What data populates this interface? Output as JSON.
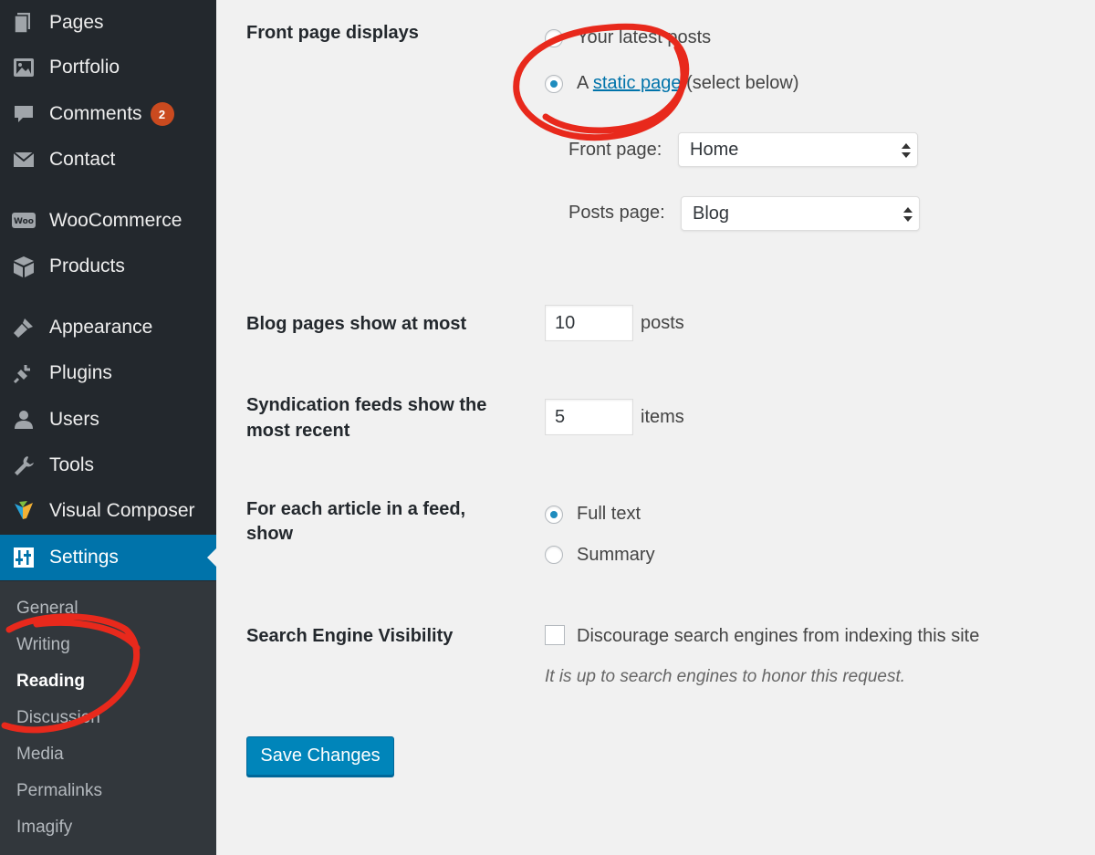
{
  "sidebar": {
    "menu": [
      {
        "label": "Pages",
        "icon": "pages-icon"
      },
      {
        "label": "Portfolio",
        "icon": "portfolio-icon"
      },
      {
        "label": "Comments",
        "icon": "comments-icon",
        "badge": "2"
      },
      {
        "label": "Contact",
        "icon": "contact-icon"
      },
      {
        "label": "WooCommerce",
        "icon": "woocommerce-icon"
      },
      {
        "label": "Products",
        "icon": "products-icon"
      },
      {
        "label": "Appearance",
        "icon": "appearance-icon"
      },
      {
        "label": "Plugins",
        "icon": "plugins-icon"
      },
      {
        "label": "Users",
        "icon": "users-icon"
      },
      {
        "label": "Tools",
        "icon": "tools-icon"
      },
      {
        "label": "Visual Composer",
        "icon": "visual-composer-icon"
      },
      {
        "label": "Settings",
        "icon": "settings-icon",
        "active": true
      }
    ],
    "submenu": [
      {
        "label": "General"
      },
      {
        "label": "Writing"
      },
      {
        "label": "Reading",
        "current": true
      },
      {
        "label": "Discussion"
      },
      {
        "label": "Media"
      },
      {
        "label": "Permalinks"
      },
      {
        "label": "Imagify"
      }
    ]
  },
  "form": {
    "front_page_displays": {
      "label": "Front page displays",
      "option_latest": "Your latest posts",
      "option_static_prefix": "A",
      "option_static_link": "static page",
      "option_static_suffix": "(select below)",
      "selected": "static",
      "front_page_label": "Front page:",
      "front_page_value": "Home",
      "posts_page_label": "Posts page:",
      "posts_page_value": "Blog"
    },
    "blog_pages": {
      "label": "Blog pages show at most",
      "value": "10",
      "unit": "posts"
    },
    "syndication": {
      "label_line1": "Syndication feeds show the",
      "label_line2": "most recent",
      "value": "5",
      "unit": "items"
    },
    "feed_article": {
      "label_line1": "For each article in a feed,",
      "label_line2": "show",
      "option_full": "Full text",
      "option_summary": "Summary",
      "selected": "full"
    },
    "search_visibility": {
      "label": "Search Engine Visibility",
      "checkbox_label": "Discourage search engines from indexing this site",
      "checked": false,
      "description": "It is up to search engines to honor this request."
    },
    "save_label": "Save Changes"
  },
  "colors": {
    "sidebar_bg": "#23282d",
    "submenu_bg": "#32373c",
    "accent": "#0073aa",
    "badge": "#ca4a1f",
    "annotation": "#e8291c"
  }
}
